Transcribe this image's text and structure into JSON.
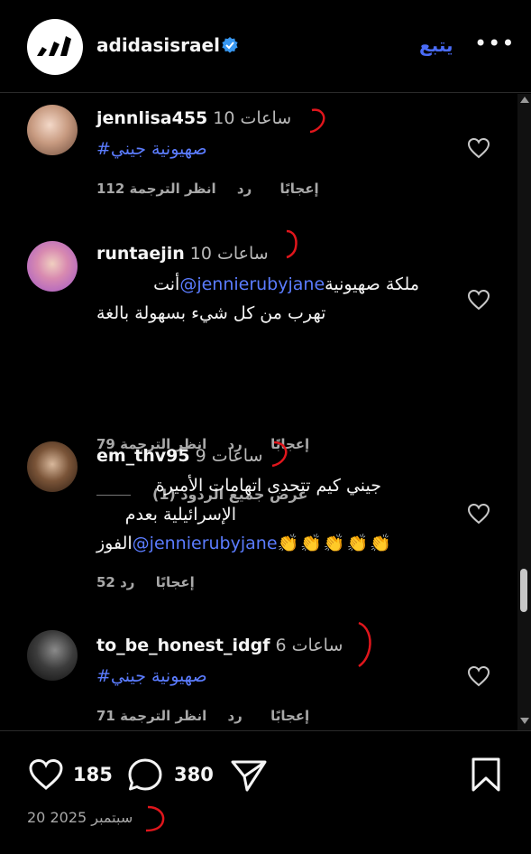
{
  "header": {
    "handle": "adidasisrael",
    "follow_label": "يتبع",
    "more_label": "•••",
    "logo_icon": "adidas-logo",
    "verified_icon": "verified-badge-icon"
  },
  "comments": [
    {
      "username": "jennlisa455",
      "time": "10 ساعات",
      "text_hashtag": "#صهيونية جيني",
      "likes": "112 إعجابًا",
      "reply": "رد",
      "translate": "انظر الترجمة"
    },
    {
      "username": "runtaejin",
      "time": "10 ساعات",
      "text_line1_prefix": "أنت",
      "mention": "@jennierubyjane",
      "text_line1_suffix": "ملكة صهيونية",
      "text_line2": "تهرب من كل شيء بسهولة بالغة",
      "likes": "79 إعجابًا",
      "reply": "رد",
      "translate": "انظر الترجمة",
      "view_replies": "عرض جميع الردود (1)"
    },
    {
      "username": "em_thv95",
      "time": "9 ساعات",
      "text_line1": "جيني كيم تتحدى اتهامات الأميرة",
      "text_line2": "الإسرائيلية بعدم",
      "text_line3_prefix": "الفوز",
      "mention": "@jennierubyjane",
      "emojis": "👏👏👏👏👏",
      "likes": "52 إعجابًا",
      "reply": "رد"
    },
    {
      "username": "to_be_honest_idgf",
      "time": "6 ساعات",
      "text_hashtag": "#صهيونية جيني",
      "likes": "71 إعجابًا",
      "reply": "رد",
      "translate": "انظر الترجمة"
    }
  ],
  "footer": {
    "likes_count": "185",
    "comments_count": "380",
    "date": "20 سبتمبر 2025",
    "icons": [
      "heart-icon",
      "comment-icon",
      "share-icon",
      "bookmark-icon"
    ]
  },
  "colors": {
    "background": "#000000",
    "accent": "#4a6cf7",
    "link": "#5b7cff",
    "muted": "#a8a8a8",
    "annotation": "#e0161c"
  }
}
